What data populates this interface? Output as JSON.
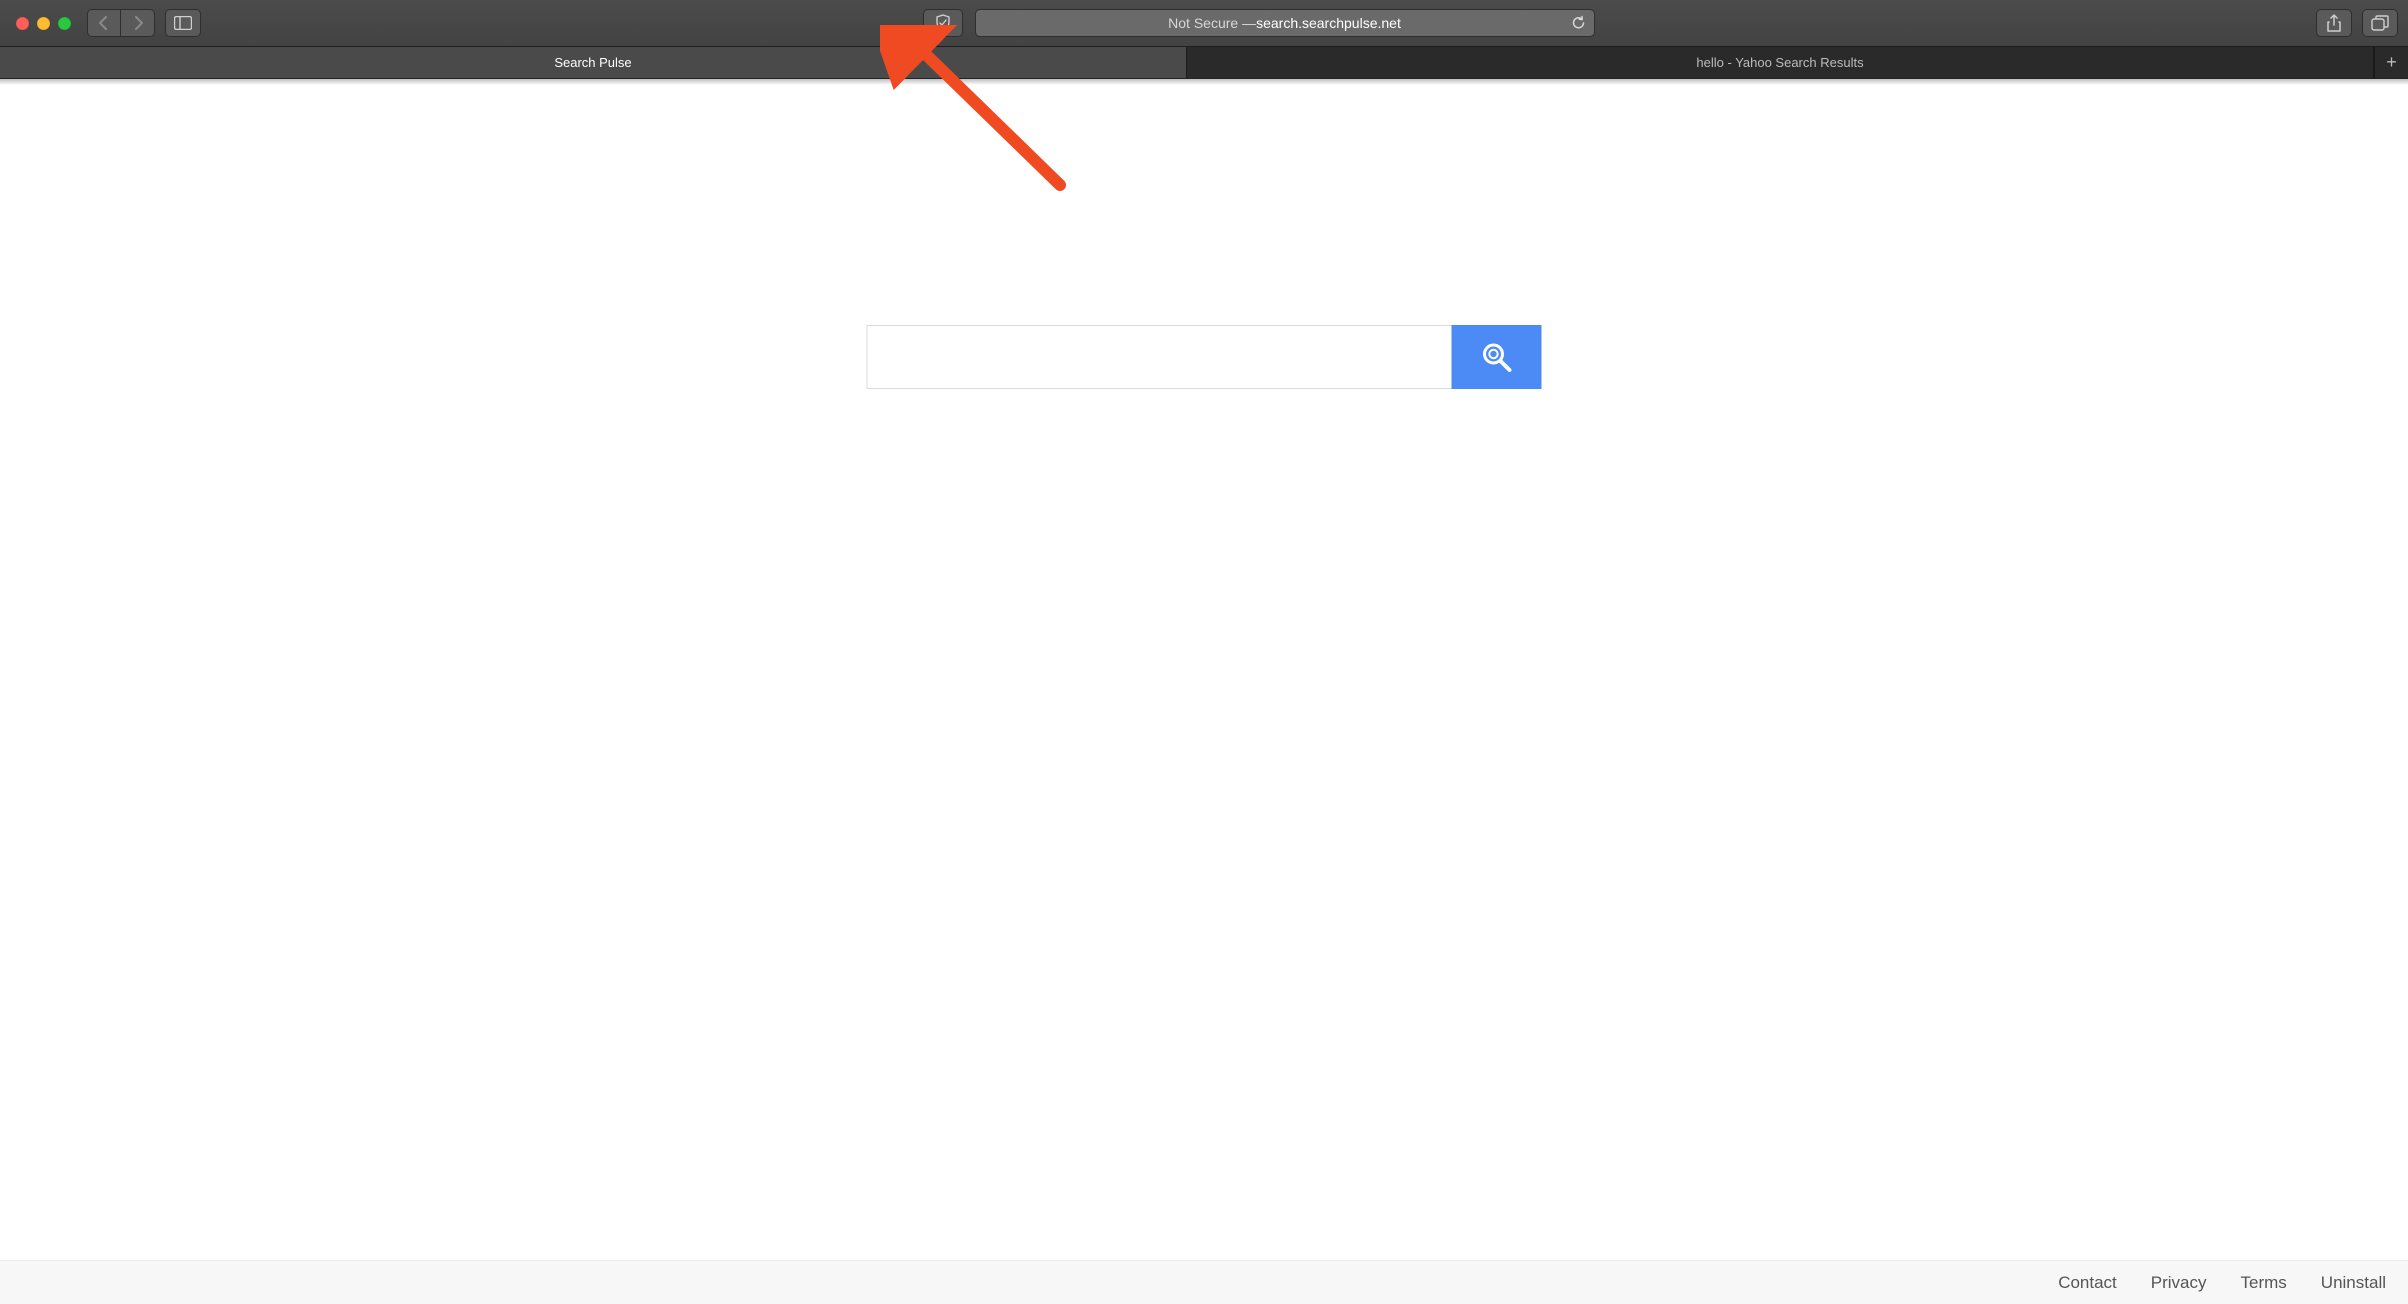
{
  "browser": {
    "address_prefix": "Not Secure — ",
    "address_host": "search.searchpulse.net",
    "tabs": [
      {
        "label": "Search Pulse",
        "active": true
      },
      {
        "label": "hello - Yahoo Search Results",
        "active": false
      }
    ]
  },
  "search": {
    "value": "",
    "placeholder": ""
  },
  "footer": {
    "links": [
      "Contact",
      "Privacy",
      "Terms",
      "Uninstall"
    ]
  },
  "colors": {
    "search_button": "#4c8bf5",
    "arrow": "#f04a23"
  }
}
